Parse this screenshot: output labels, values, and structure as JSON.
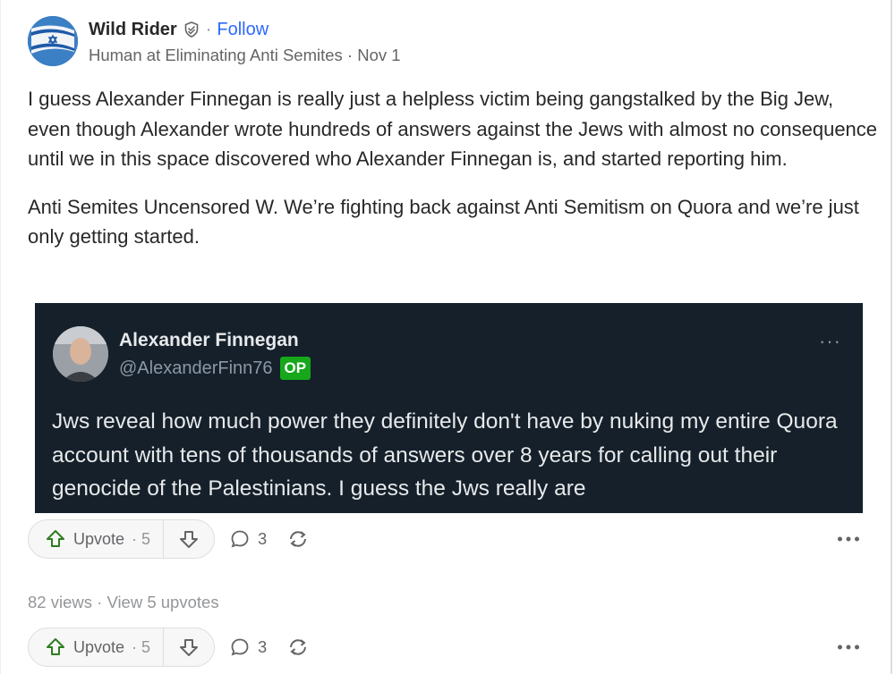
{
  "post": {
    "author": {
      "name": "Wild Rider",
      "separator": "·",
      "follow_label": "Follow",
      "credential": "Human at Eliminating Anti Semites",
      "date_separator": " · ",
      "date": "Nov 1",
      "verified_icon": "shield-check-icon"
    },
    "paragraphs": [
      "I guess Alexander Finnegan is really just a helpless victim being gangstalked by the Big Jew, even though Alexander wrote hundreds of answers against the Jews with almost no consequence until we in this space discovered who Alexander Finnegan is, and started reporting him.",
      "Anti Semites Uncensored W. We’re fighting back against Anti Semitism on Quora and we’re just only getting started."
    ],
    "embed": {
      "name": "Alexander Finnegan",
      "handle": "@AlexanderFinn76",
      "badge": "OP",
      "more": "···",
      "text": "Jws reveal how much power they definitely don't  have by nuking my entire Quora account with tens of thousands of answers over 8 years for calling out their genocide of the Palestinians.  I guess the Jws really are"
    }
  },
  "actions_top": {
    "upvote_label": "Upvote",
    "upvote_count": "· 5",
    "comment_count": "3"
  },
  "stats": {
    "views": "82 views",
    "separator": " · ",
    "view_upvotes": "View 5 upvotes"
  },
  "actions_bottom": {
    "upvote_label": "Upvote",
    "upvote_count": "· 5",
    "comment_count": "3"
  },
  "colors": {
    "upvote_green": "#2e7d1f",
    "link_blue": "#2e69ff",
    "embed_bg": "#15202b",
    "op_badge": "#16a71b"
  }
}
